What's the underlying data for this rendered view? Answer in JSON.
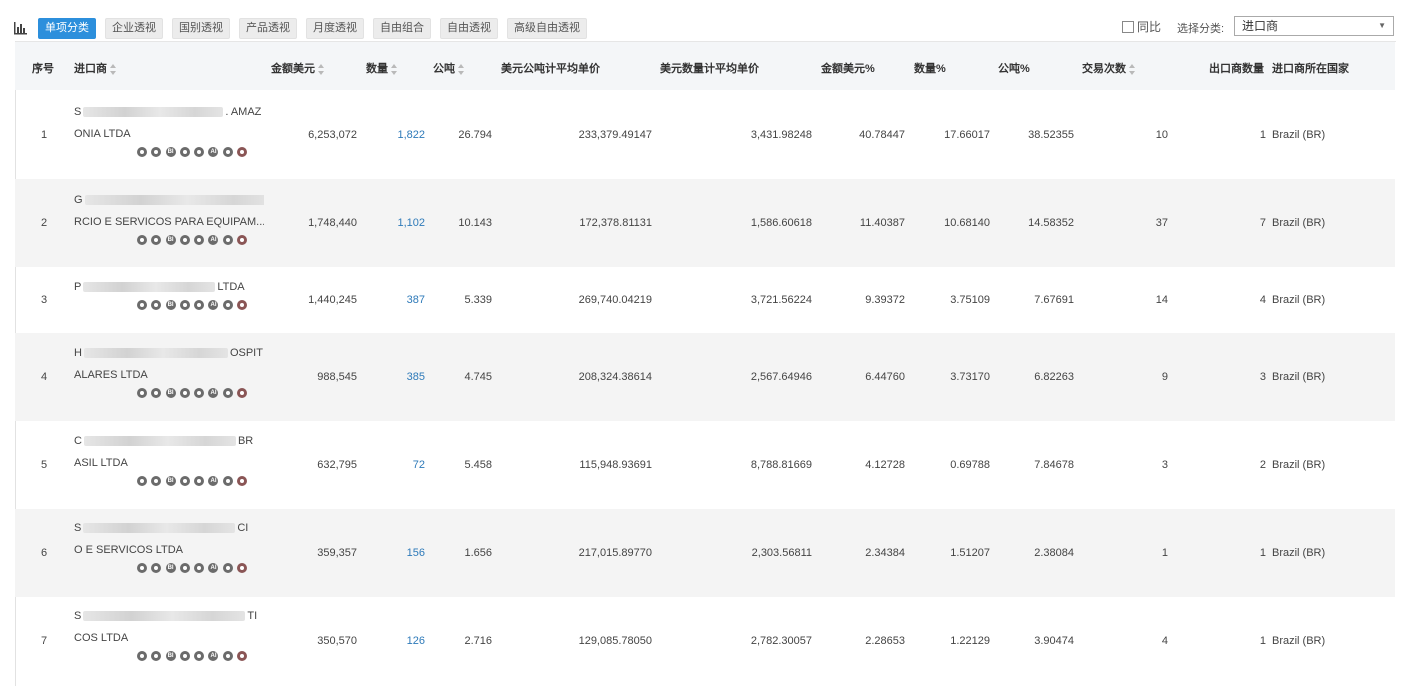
{
  "toolbar": {
    "tabs": [
      {
        "label": "单项分类",
        "active": true
      },
      {
        "label": "企业透视",
        "active": false
      },
      {
        "label": "国别透视",
        "active": false
      },
      {
        "label": "产品透视",
        "active": false
      },
      {
        "label": "月度透视",
        "active": false
      },
      {
        "label": "自由组合",
        "active": false
      },
      {
        "label": "自由透视",
        "active": false
      },
      {
        "label": "高级自由透视",
        "active": false
      }
    ],
    "yoy_label": "同比",
    "category_label": "选择分类:",
    "category_value": "进口商"
  },
  "table": {
    "columns": [
      "序号",
      "进口商",
      "金额美元",
      "数量",
      "公吨",
      "美元公吨计平均单价",
      "美元数量计平均单价",
      "金额美元%",
      "数量%",
      "公吨%",
      "交易次数",
      "出口商数量",
      "进口商所在国家"
    ],
    "rows": [
      {
        "no": "1",
        "name_line1_start": "S",
        "name_line1_end": ". AMAZ",
        "name_line2": "ONIA LTDA",
        "amount": "6,253,072",
        "qty": "1,822",
        "ton": "26.794",
        "price_ton": "233,379.49147",
        "price_qty": "3,431.98248",
        "amount_pct": "40.78447",
        "qty_pct": "17.66017",
        "ton_pct": "38.52355",
        "trades": "10",
        "exporters": "1",
        "country": "Brazil (BR)"
      },
      {
        "no": "2",
        "name_line1_start": "G",
        "name_line1_end": "",
        "name_line2": "RCIO E SERVICOS PARA EQUIPAM...",
        "amount": "1,748,440",
        "qty": "1,102",
        "ton": "10.143",
        "price_ton": "172,378.81131",
        "price_qty": "1,586.60618",
        "amount_pct": "11.40387",
        "qty_pct": "10.68140",
        "ton_pct": "14.58352",
        "trades": "37",
        "exporters": "7",
        "country": "Brazil (BR)"
      },
      {
        "no": "3",
        "name_line1_start": "P",
        "name_line1_end": "LTDA",
        "name_line2": "",
        "amount": "1,440,245",
        "qty": "387",
        "ton": "5.339",
        "price_ton": "269,740.04219",
        "price_qty": "3,721.56224",
        "amount_pct": "9.39372",
        "qty_pct": "3.75109",
        "ton_pct": "7.67691",
        "trades": "14",
        "exporters": "4",
        "country": "Brazil (BR)"
      },
      {
        "no": "4",
        "name_line1_start": "H",
        "name_line1_end": "OSPIT",
        "name_line2": "ALARES LTDA",
        "amount": "988,545",
        "qty": "385",
        "ton": "4.745",
        "price_ton": "208,324.38614",
        "price_qty": "2,567.64946",
        "amount_pct": "6.44760",
        "qty_pct": "3.73170",
        "ton_pct": "6.82263",
        "trades": "9",
        "exporters": "3",
        "country": "Brazil (BR)"
      },
      {
        "no": "5",
        "name_line1_start": "C",
        "name_line1_end": "BR",
        "name_line2": "ASIL LTDA",
        "amount": "632,795",
        "qty": "72",
        "ton": "5.458",
        "price_ton": "115,948.93691",
        "price_qty": "8,788.81669",
        "amount_pct": "4.12728",
        "qty_pct": "0.69788",
        "ton_pct": "7.84678",
        "trades": "3",
        "exporters": "2",
        "country": "Brazil (BR)"
      },
      {
        "no": "6",
        "name_line1_start": "S",
        "name_line1_end": "CI",
        "name_line2": "O E SERVICOS LTDA",
        "amount": "359,357",
        "qty": "156",
        "ton": "1.656",
        "price_ton": "217,015.89770",
        "price_qty": "2,303.56811",
        "amount_pct": "2.34384",
        "qty_pct": "1.51207",
        "ton_pct": "2.38084",
        "trades": "1",
        "exporters": "1",
        "country": "Brazil (BR)"
      },
      {
        "no": "7",
        "name_line1_start": "S",
        "name_line1_end": "TI",
        "name_line2": "COS LTDA",
        "amount": "350,570",
        "qty": "126",
        "ton": "2.716",
        "price_ton": "129,085.78050",
        "price_qty": "2,782.30057",
        "amount_pct": "2.28653",
        "qty_pct": "1.22129",
        "ton_pct": "3.90474",
        "trades": "4",
        "exporters": "1",
        "country": "Brazil (BR)"
      }
    ]
  },
  "row_icons": [
    "target-icon",
    "compass-icon",
    "bi-icon",
    "document-icon",
    "globe-icon",
    "ai-icon",
    "people-icon",
    "grid-globe-icon"
  ]
}
